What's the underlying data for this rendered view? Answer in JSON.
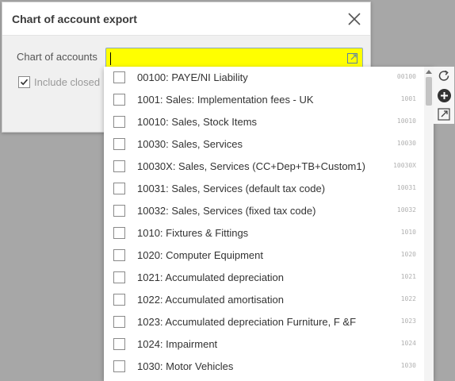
{
  "dialog": {
    "title": "Chart of account export",
    "chart_of_accounts_label": "Chart of accounts",
    "chart_of_accounts_value": "",
    "include_closed_label": "Include closed",
    "include_closed_checked": true
  },
  "dropdown": {
    "items": [
      {
        "label": "00100: PAYE/NI Liability",
        "code": "00100"
      },
      {
        "label": "1001: Sales: Implementation fees - UK",
        "code": "1001"
      },
      {
        "label": "10010: Sales, Stock Items",
        "code": "10010"
      },
      {
        "label": "10030: Sales, Services",
        "code": "10030"
      },
      {
        "label": "10030X: Sales, Services (CC+Dep+TB+Custom1)",
        "code": "10030X"
      },
      {
        "label": "10031: Sales, Services (default tax code)",
        "code": "10031"
      },
      {
        "label": "10032: Sales, Services (fixed tax code)",
        "code": "10032"
      },
      {
        "label": "1010: Fixtures & Fittings",
        "code": "1010"
      },
      {
        "label": "1020: Computer Equipment",
        "code": "1020"
      },
      {
        "label": "1021: Accumulated depreciation",
        "code": "1021"
      },
      {
        "label": "1022: Accumulated amortisation",
        "code": "1022"
      },
      {
        "label": "1023: Accumulated depreciation Furniture, F &F",
        "code": "1023"
      },
      {
        "label": "1024: Impairment",
        "code": "1024"
      },
      {
        "label": "1030: Motor Vehicles",
        "code": "1030"
      }
    ]
  },
  "icons": {
    "close": "close-icon",
    "open_external": "open-external-icon",
    "refresh": "refresh-icon",
    "add": "add-circle-icon",
    "side_open": "open-external-icon",
    "checkmark": "checkmark-icon"
  },
  "colors": {
    "input_highlight": "#ffff00",
    "overlay": "#a7a7a7"
  }
}
